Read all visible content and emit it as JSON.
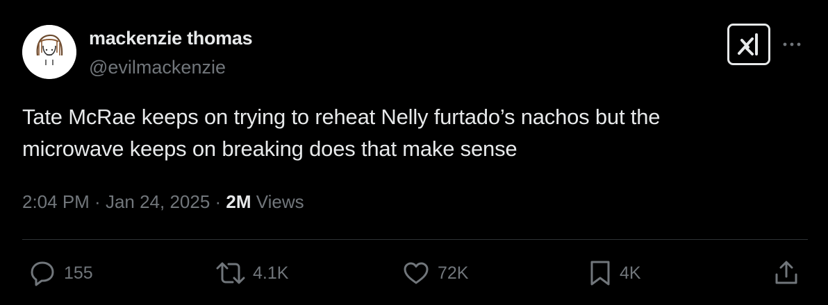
{
  "user": {
    "display_name": "mackenzie thomas",
    "handle": "@evilmackenzie"
  },
  "tweet": {
    "text_line1": "Tate McRae keeps on trying to reheat Nelly furtado’s nachos but the",
    "text_line2": "microwave keeps on breaking does that make sense"
  },
  "meta": {
    "time": "2:04 PM",
    "separator1": " · ",
    "date": "Jan 24, 2025",
    "separator2": " · ",
    "views_count": "2M",
    "views_label": " Views"
  },
  "actions": {
    "replies": "155",
    "reposts": "4.1K",
    "likes": "72K",
    "bookmarks": "4K"
  },
  "icons": {
    "avatar": "avatar-drawing",
    "grok": "grok-icon",
    "more": "more-icon",
    "reply": "reply-icon",
    "repost": "repost-icon",
    "like": "heart-icon",
    "bookmark": "bookmark-icon",
    "share": "share-icon"
  },
  "colors": {
    "background": "#000000",
    "primary_text": "#e7e9ea",
    "secondary_text": "#71767b",
    "divider": "#2f3336"
  }
}
